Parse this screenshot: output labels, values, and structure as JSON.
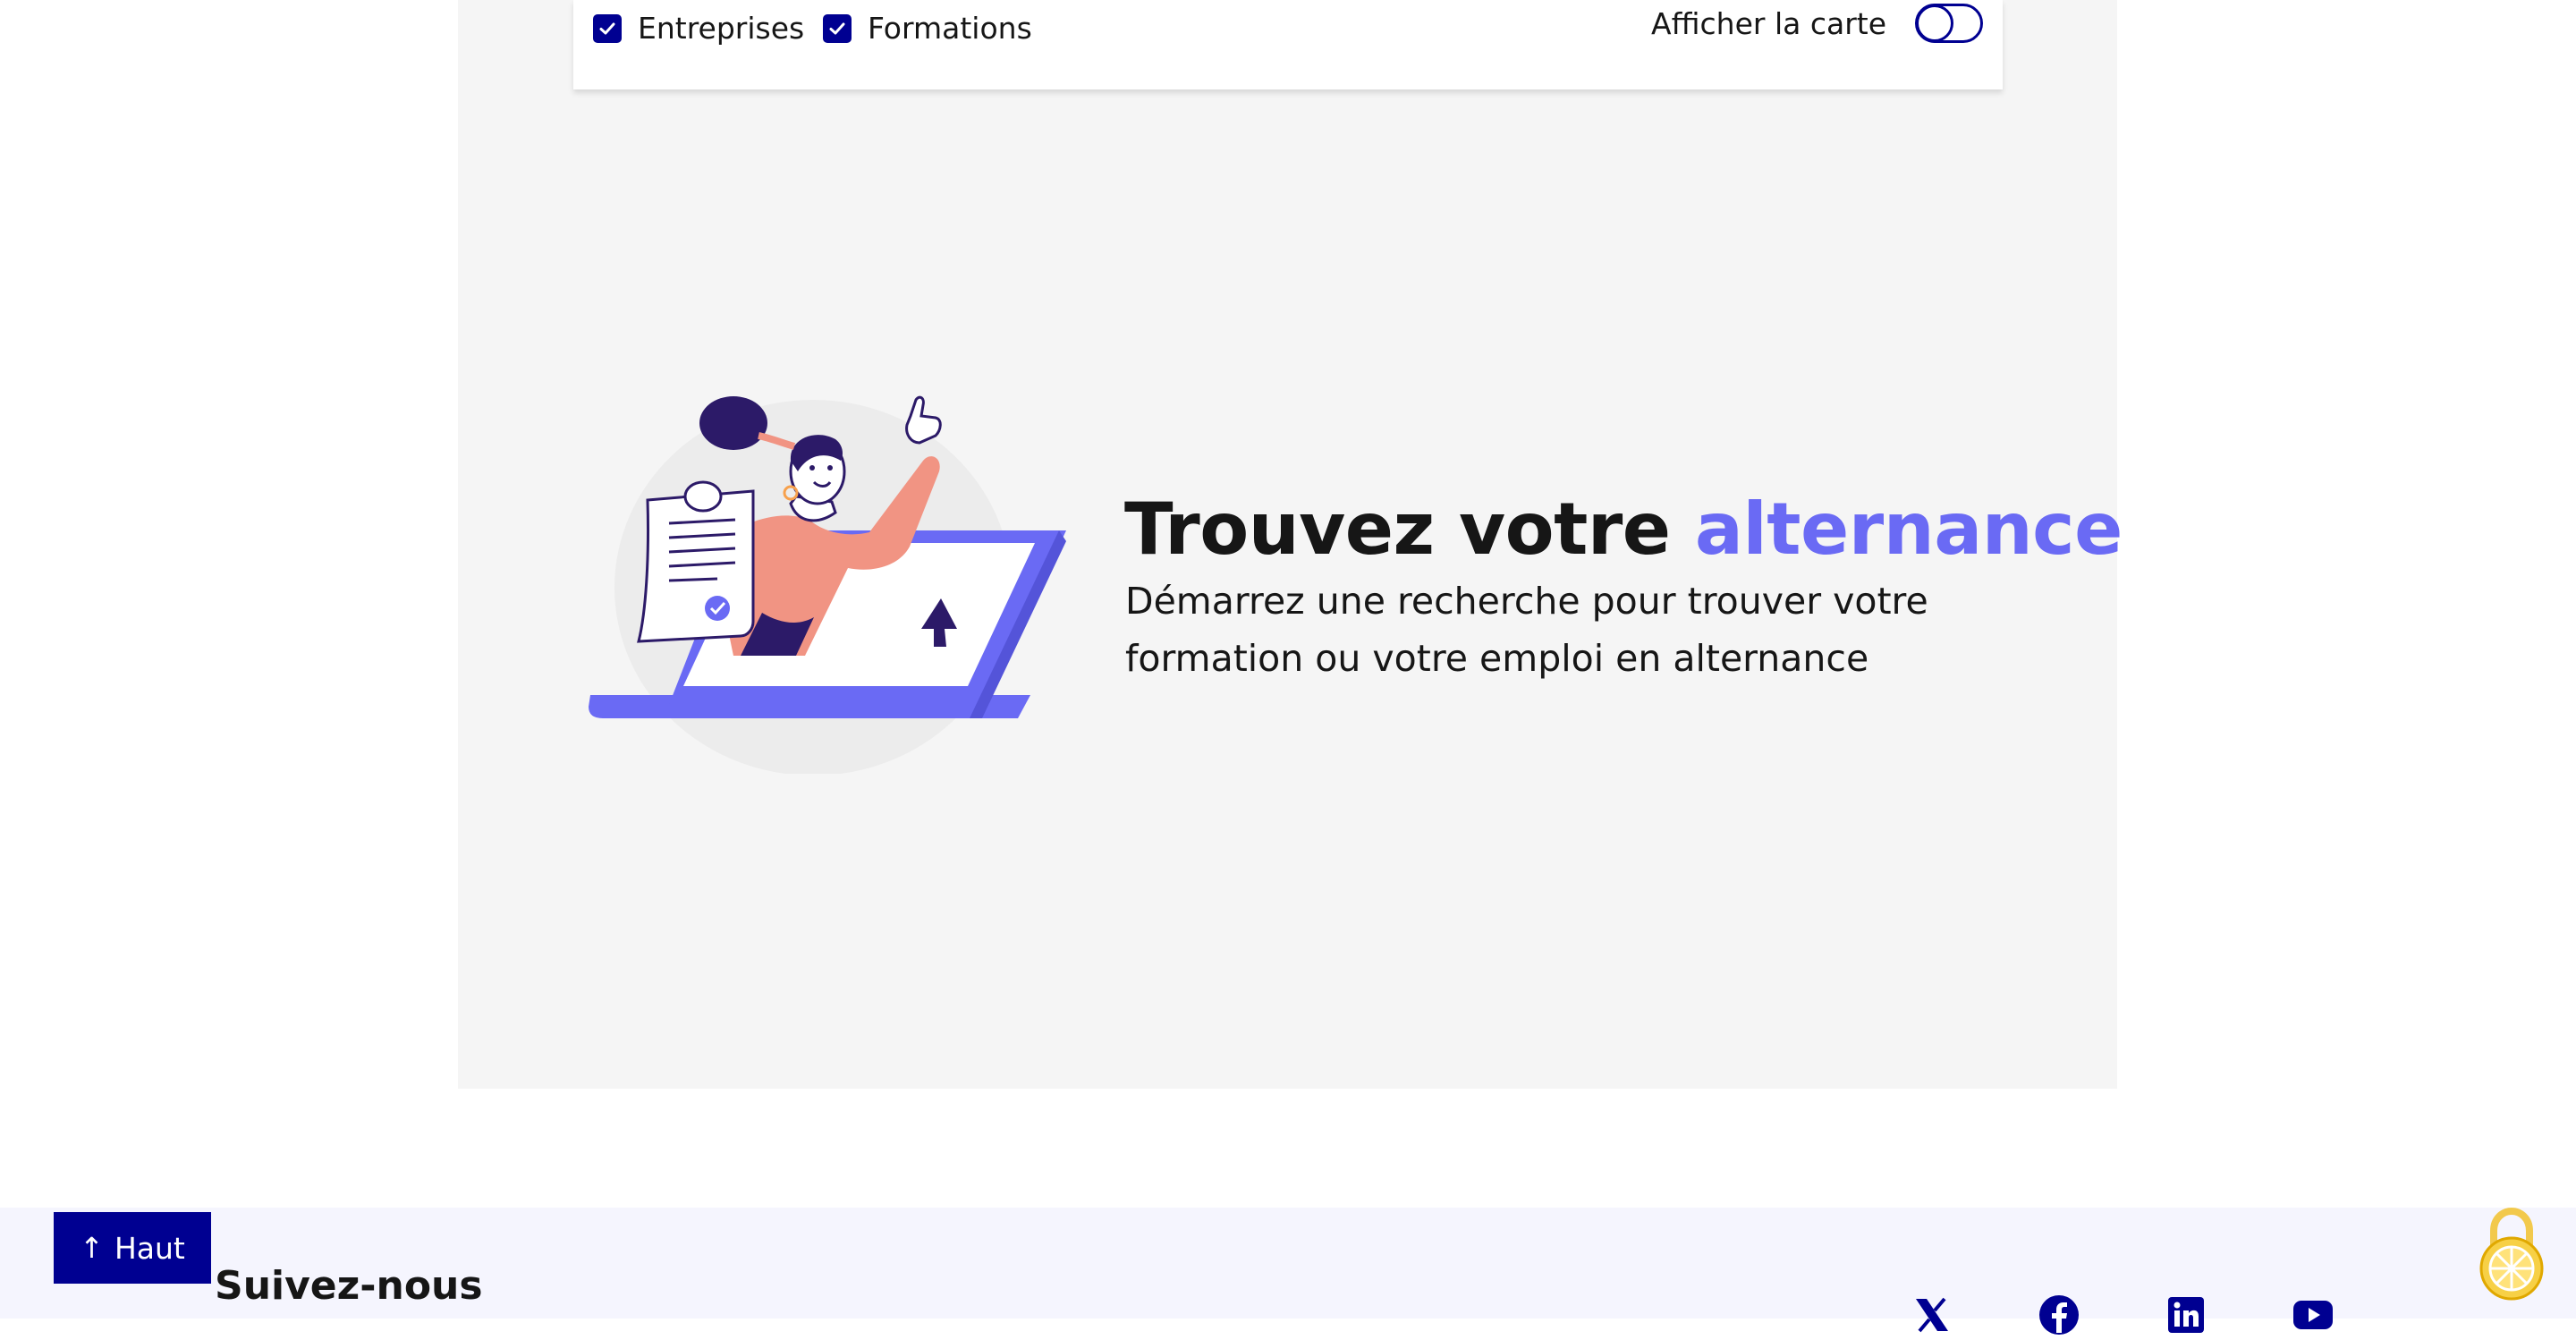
{
  "filters": {
    "entreprises_label": "Entreprises",
    "entreprises_checked": true,
    "formations_label": "Formations",
    "formations_checked": true,
    "map_toggle_label": "Afficher la carte",
    "map_toggle_on": false
  },
  "hero": {
    "title_part1": "Trouvez votre ",
    "title_accent": "alternance",
    "subtitle": "Démarrez une recherche pour trouver votre formation ou votre emploi en alternance"
  },
  "footer": {
    "back_to_top_label": "Haut",
    "follow_title": "Suivez-nous",
    "social_icons": [
      "x-twitter-icon",
      "facebook-icon",
      "linkedin-icon",
      "youtube-icon"
    ]
  },
  "colors": {
    "primary_blue": "#000091",
    "accent_purple": "#6a6af4",
    "panel_grey": "#f5f5f5",
    "footer_bg": "#f5f5fe",
    "illustration_salmon": "#f19483",
    "illustration_dark": "#2c1a68"
  }
}
